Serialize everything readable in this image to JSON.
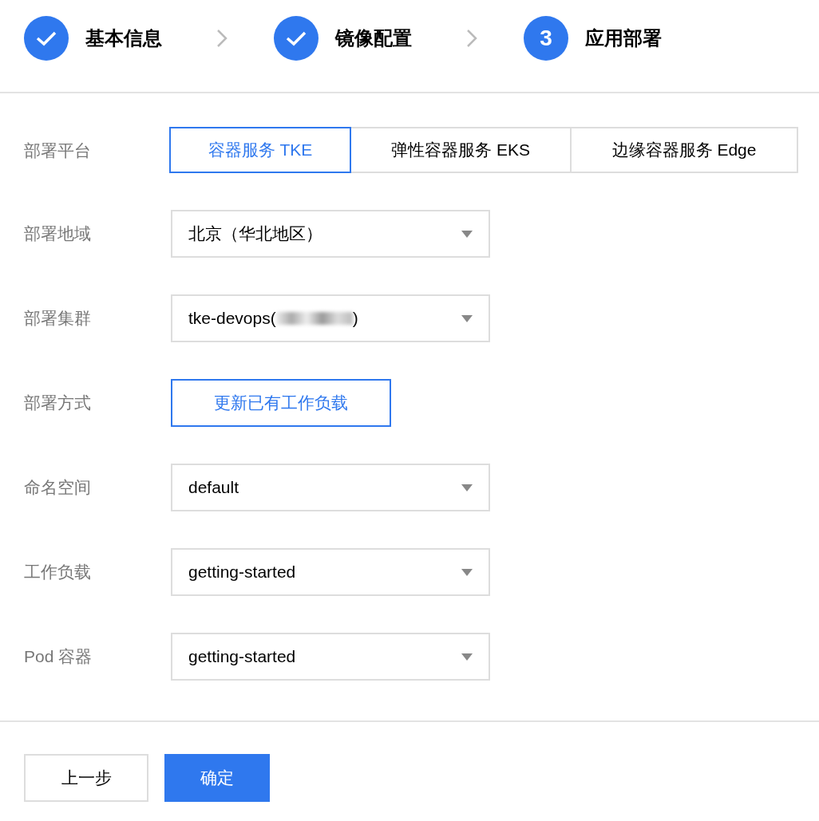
{
  "steps": [
    {
      "kind": "done",
      "label": "基本信息"
    },
    {
      "kind": "done",
      "label": "镜像配置"
    },
    {
      "kind": "current",
      "number": "3",
      "label": "应用部署"
    }
  ],
  "form": [
    {
      "kind": "segmented",
      "label": "部署平台",
      "options": [
        {
          "label": "容器服务 TKE",
          "selected": true
        },
        {
          "label": "弹性容器服务 EKS",
          "selected": false
        },
        {
          "label": "边缘容器服务 Edge",
          "selected": false
        }
      ]
    },
    {
      "kind": "select",
      "label": "部署地域",
      "value": "北京（华北地区）"
    },
    {
      "kind": "select",
      "label": "部署集群",
      "value": "tke-devops(",
      "redacted": true,
      "value_end": ")"
    },
    {
      "kind": "button",
      "label": "部署方式",
      "value": "更新已有工作负载"
    },
    {
      "kind": "select",
      "label": "命名空间",
      "value": "default"
    },
    {
      "kind": "select",
      "label": "工作负载",
      "value": "getting-started"
    },
    {
      "kind": "select",
      "label": "Pod 容器",
      "value": "getting-started"
    }
  ],
  "buttons": [
    {
      "kind": "secondary",
      "label": "上一步"
    },
    {
      "kind": "primary",
      "label": "确定"
    }
  ]
}
